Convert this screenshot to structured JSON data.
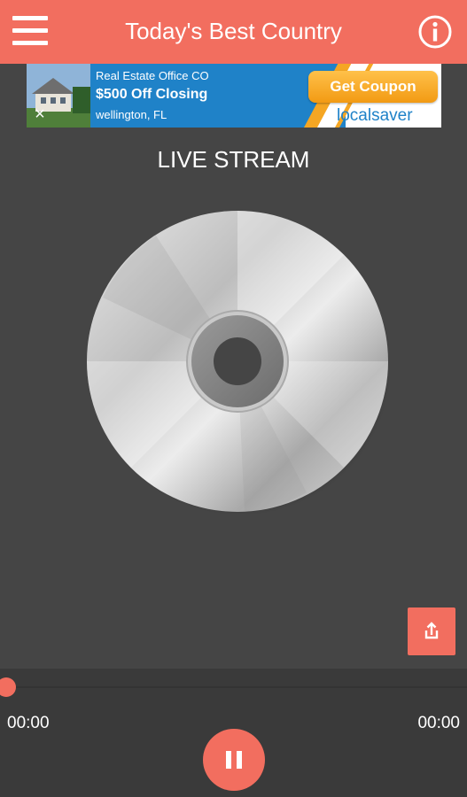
{
  "header": {
    "title": "Today's Best Country",
    "menu_icon": "hamburger-menu-icon",
    "info_icon": "info-icon",
    "accent_color": "#f26e5f"
  },
  "ad": {
    "company": "Real Estate Office CO",
    "offer": "$500 Off Closing",
    "location": "wellington, FL",
    "cta": "Get Coupon",
    "brand": "localsaver",
    "close_icon": "close-icon"
  },
  "main": {
    "stream_title": "LIVE STREAM",
    "artwork_icon": "cd-disc-icon",
    "share_icon": "share-icon"
  },
  "player": {
    "elapsed": "00:00",
    "duration": "00:00",
    "progress": 0,
    "pause_icon": "pause-icon"
  }
}
